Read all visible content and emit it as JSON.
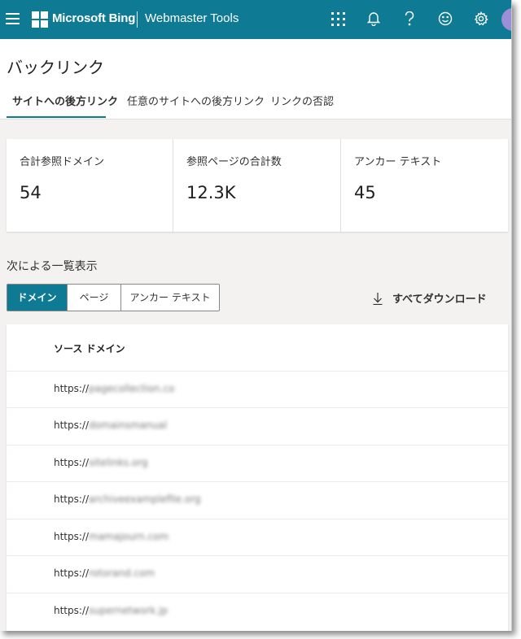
{
  "topbar": {
    "brand": "Microsoft Bing",
    "product": "Webmaster Tools",
    "icons": [
      "menu-icon",
      "app-launcher-icon",
      "bell-icon",
      "help-icon",
      "smiley-icon",
      "gear-icon"
    ],
    "accent": "#0e7a93"
  },
  "page": {
    "title": "バックリンク",
    "tabs": [
      {
        "label": "サイトへの後方リンク",
        "active": true
      },
      {
        "label": "任意のサイトへの後方リンク",
        "active": false
      },
      {
        "label": "リンクの否認",
        "active": false
      }
    ]
  },
  "metrics": [
    {
      "label": "合計参照ドメイン",
      "value": "54"
    },
    {
      "label": "参照ページの合計数",
      "value": "12.3K"
    },
    {
      "label": "アンカー テキスト",
      "value": "45"
    }
  ],
  "view": {
    "label": "次による一覧表示",
    "options": [
      "ドメイン",
      "ページ",
      "アンカー テキスト"
    ],
    "selected": "ドメイン",
    "download_label": "すべてダウンロード"
  },
  "table": {
    "column": "ソース ドメイン",
    "rows": [
      {
        "prefix": "https://",
        "rest": "pagecollection.co"
      },
      {
        "prefix": "https://",
        "rest": "domainsmanual"
      },
      {
        "prefix": "https://",
        "rest": "sitelinks.org"
      },
      {
        "prefix": "https://",
        "rest": "archiveexamplefile.org"
      },
      {
        "prefix": "https://",
        "rest": "mamajourn.com"
      },
      {
        "prefix": "https://",
        "rest": "rotorand.com"
      },
      {
        "prefix": "https://",
        "rest": "supernetwork.jp"
      }
    ]
  }
}
